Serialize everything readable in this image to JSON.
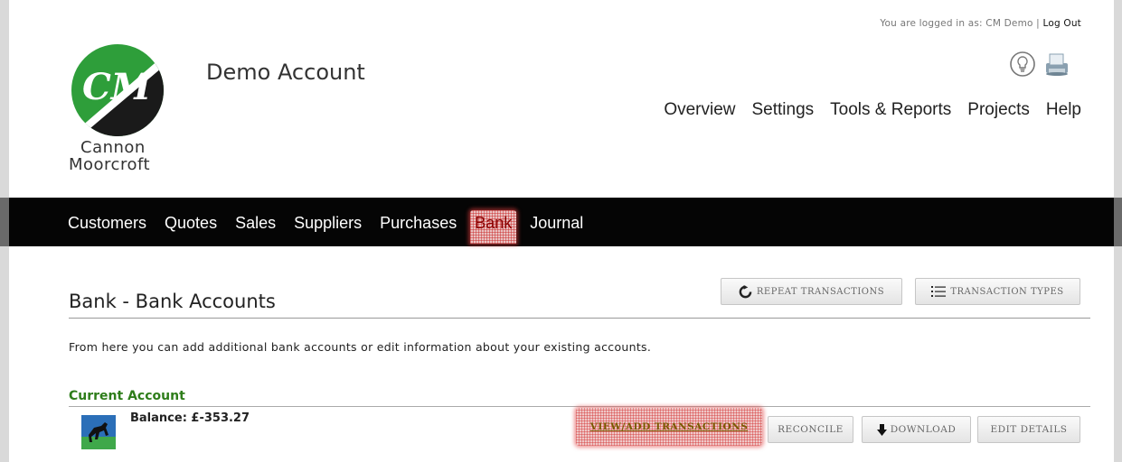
{
  "header": {
    "login_prefix": "You are logged in as: CM Demo |",
    "logout_label": "Log Out",
    "account_title": "Demo Account",
    "logo_line1": "Cannon",
    "logo_line2": "Moorcroft",
    "logo_mark": "CM",
    "icons": [
      "lightbulb-icon",
      "printer-icon"
    ]
  },
  "main_nav": [
    "Overview",
    "Settings",
    "Tools & Reports",
    "Projects",
    "Help"
  ],
  "sub_nav": {
    "items": [
      "Customers",
      "Quotes",
      "Sales",
      "Suppliers",
      "Purchases",
      "Bank",
      "Journal"
    ],
    "active": "Bank"
  },
  "page": {
    "title": "Bank - Bank Accounts",
    "repeat_btn": "REPEAT TRANSACTIONS",
    "types_btn": "TRANSACTION TYPES",
    "intro": "From here you can add additional bank accounts or edit information about your existing accounts."
  },
  "account": {
    "name": "Current Account",
    "balance": "Balance: £-353.27",
    "actions": {
      "view": "VIEW/ADD TRANSACTIONS",
      "reconcile": "RECONCILE",
      "download": "DOWNLOAD",
      "edit": "EDIT DETAILS"
    }
  },
  "colors": {
    "logo_green": "#2e9e3a",
    "account_green": "#2e7d1a",
    "nav_bar": "#050505",
    "highlight": "#e9c3c3"
  }
}
